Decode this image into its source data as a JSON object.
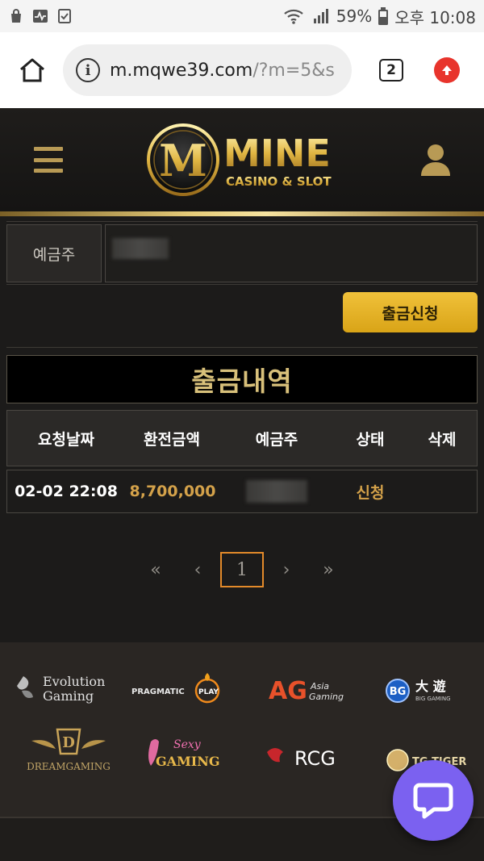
{
  "status_bar": {
    "battery": "59%",
    "time": "오후 10:08"
  },
  "browser": {
    "url_main": "m.mqwe39.com",
    "url_rest": "/?m=5&s",
    "tab_count": "2"
  },
  "header": {
    "logo_title": "MINE",
    "logo_subtitle": "CASINO & SLOT",
    "logo_mark": "M"
  },
  "form": {
    "depositor_label": "예금주",
    "withdraw_button": "출금신청"
  },
  "history": {
    "title": "출금내역",
    "columns": [
      "요청날짜",
      "환전금액",
      "예금주",
      "상태",
      "삭제"
    ],
    "rows": [
      {
        "date": "02-02 22:08",
        "amount": "8,700,000",
        "depositor": "",
        "status": "신청",
        "delete": ""
      }
    ]
  },
  "pagination": {
    "first": "«",
    "prev": "‹",
    "current": "1",
    "next": "›",
    "last": "»"
  },
  "providers": {
    "evolution": [
      "Evolution",
      "Gaming"
    ],
    "pragmatic": [
      "PRAGMATIC",
      "PLAY"
    ],
    "ag": [
      "AG",
      "Asia",
      "Gaming"
    ],
    "bg": [
      "BG",
      "大 遊",
      "BIG GAMING"
    ],
    "dream": "DREAMGAMING",
    "sexy": [
      "Sexy",
      "GAMING"
    ],
    "rcg": "RCG",
    "tg": "TG TIGER"
  }
}
